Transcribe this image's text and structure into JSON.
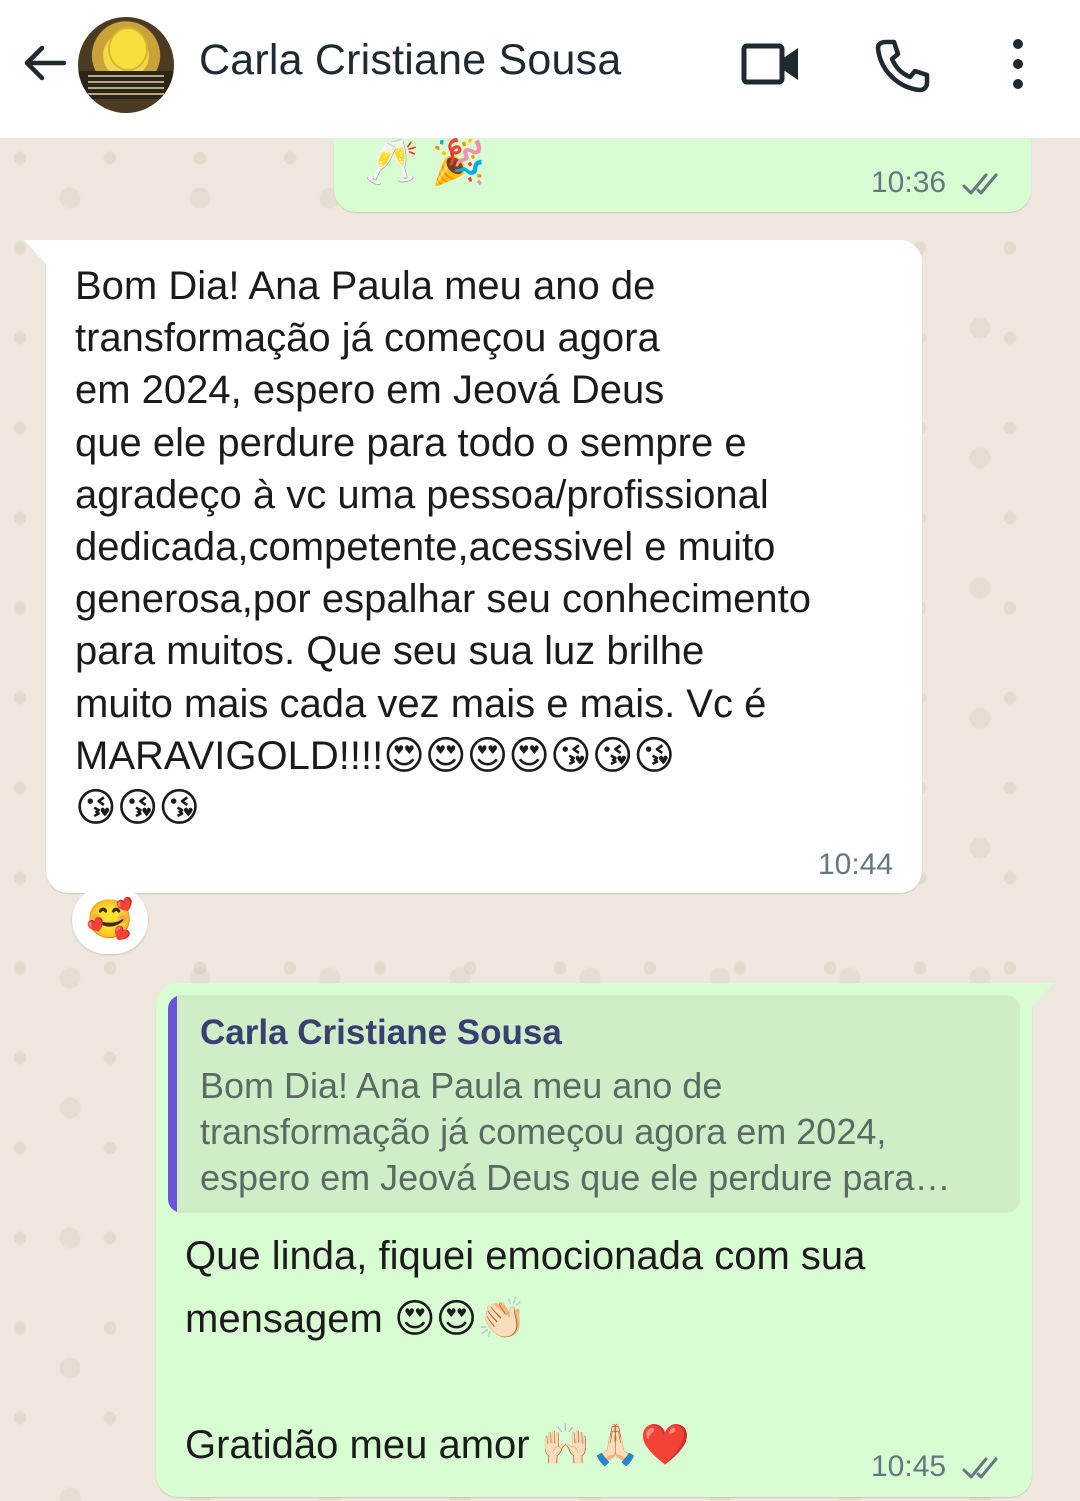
{
  "header": {
    "contact_name": "Carla Cristiane Sousa",
    "icons": {
      "back": "arrow-left-icon",
      "video": "video-call-icon",
      "call": "phone-icon",
      "menu": "more-vertical-icon"
    }
  },
  "messages": [
    {
      "direction": "outgoing",
      "text": "🥂 🎉",
      "time": "10:36",
      "status": "read"
    },
    {
      "direction": "incoming",
      "text": "Bom Dia! Ana Paula meu ano de\ntransformação já  começou agora\nem 2024, espero em Jeová  Deus\nque ele perdure para todo o sempre e\nagradeço à vc uma pessoa/profissional\ndedicada,competente,acessivel e muito\ngenerosa,por espalhar seu conhecimento\npara muitos. Que seu sua luz brilhe\nmuito mais cada vez mais e mais. Vc é\nMARAVIGOLD!!!!😍😍😍😍😘😘😘\n😘😘😘",
      "time": "10:44",
      "reaction": "🥰"
    },
    {
      "direction": "outgoing",
      "quote_author": "Carla Cristiane Sousa",
      "quote_text": "Bom Dia! Ana Paula meu ano de\ntransformação já  começou agora em 2024,\nespero em Jeová  Deus que ele perdure para…",
      "text": "Que linda, fiquei emocionada com sua\nmensagem 😍😍👏🏻\n\nGratidão meu amor 🙌🏻🙏🏻❤️",
      "time": "10:45",
      "status": "read"
    }
  ],
  "colors": {
    "outgoing_bubble": "#d9fdd3",
    "incoming_bubble": "#ffffff",
    "quote_bar": "#6a55d9",
    "wallpaper": "#efe7dd"
  }
}
